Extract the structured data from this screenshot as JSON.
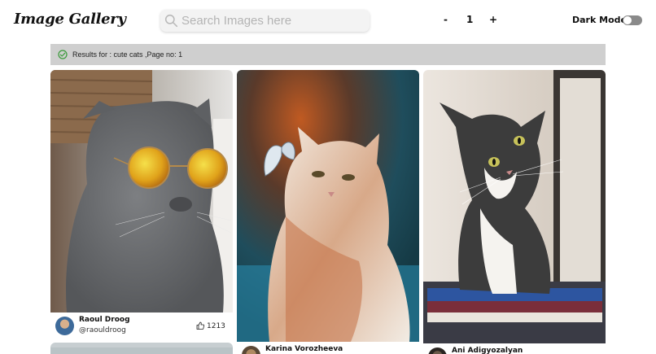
{
  "header": {
    "logo": "Image Gallery",
    "search_placeholder": "Search Images here",
    "search_value": "",
    "pager": {
      "minus": "-",
      "page": "1",
      "plus": "+"
    },
    "dark_mode_label": "Dark Mode",
    "dark_mode_on": false
  },
  "results": {
    "text": "Results for : cute cats ,Page no: 1"
  },
  "cards": [
    {
      "name": "Raoul Droog",
      "handle": "@raouldroog",
      "likes": "1213"
    },
    {
      "name": "Karina Vorozheeva",
      "handle": "",
      "likes": ""
    },
    {
      "name": "Ani Adigyozalyan",
      "handle": "",
      "likes": ""
    }
  ],
  "colors": {
    "results_bar": "#cfcfcf",
    "check_icon": "#3a9a3a",
    "toggle_off": "#8a8a8a"
  },
  "icons": [
    "search-icon",
    "check-circle-icon",
    "thumbs-up-icon"
  ]
}
